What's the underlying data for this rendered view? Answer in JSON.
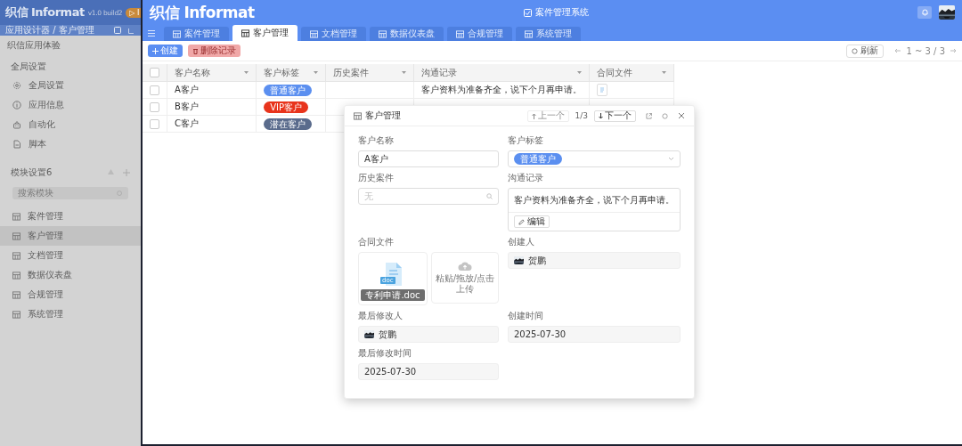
{
  "designer": {
    "logo": "织信 Informat",
    "version": "v1.0 build2",
    "badge": "▷ I",
    "breadcrumb": "应用设计器 / 客户管理",
    "app_name": "织信应用体验",
    "global_section": "全局设置",
    "global_items": [
      {
        "label": "全局设置",
        "kind": "gear"
      },
      {
        "label": "应用信息",
        "kind": "info"
      },
      {
        "label": "自动化",
        "kind": "robot"
      },
      {
        "label": "脚本",
        "kind": "script"
      }
    ],
    "module_section": "模块设置6",
    "module_search": {
      "placeholder": "搜索模块"
    },
    "modules": [
      {
        "label": "案件管理",
        "selected": false
      },
      {
        "label": "客户管理",
        "selected": true
      },
      {
        "label": "文档管理",
        "selected": false
      },
      {
        "label": "数据仪表盘",
        "selected": false
      },
      {
        "label": "合规管理",
        "selected": false
      },
      {
        "label": "系统管理",
        "selected": false
      }
    ]
  },
  "app": {
    "logo": "织信 Informat",
    "title": "案件管理系统",
    "tabs": [
      {
        "label": "案件管理",
        "selected": false
      },
      {
        "label": "客户管理",
        "selected": true
      },
      {
        "label": "文档管理",
        "selected": false
      },
      {
        "label": "数据仪表盘",
        "selected": false
      },
      {
        "label": "合规管理",
        "selected": false
      },
      {
        "label": "系统管理",
        "selected": false
      }
    ],
    "toolbar": {
      "create": {
        "label": "创建",
        "disabled": false
      },
      "delete": {
        "label": "删除记录",
        "disabled": true
      },
      "refresh": "刷新",
      "pager": "1 ~ 3 / 3"
    },
    "table": {
      "select_all": false,
      "columns": [
        "客户名称",
        "客户标签",
        "历史案件",
        "沟通记录",
        "合同文件"
      ],
      "rows": [
        {
          "checked": false,
          "name": "A客户",
          "tag": {
            "label": "普通客户",
            "color": "#5b8ff0"
          },
          "note": "客户资料为准备齐全，说下个月再申请。",
          "has_file": true
        },
        {
          "checked": false,
          "name": "B客户",
          "tag": {
            "label": "VIP客户",
            "color": "#e8341c"
          }
        },
        {
          "checked": false,
          "name": "C客户",
          "tag": {
            "label": "潜在客户",
            "color": "#5a6b8c"
          }
        }
      ]
    }
  },
  "dialog": {
    "title": "客户管理",
    "prev": {
      "label": "上一个",
      "disabled": true
    },
    "position": "1/3",
    "next": {
      "label": "下一个",
      "disabled": false
    },
    "fields": [
      {
        "kind": "text",
        "label": "客户名称",
        "value": "A客户"
      },
      {
        "kind": "tag",
        "label": "客户标签",
        "tag": {
          "label": "普通客户",
          "color": "#5b8ff0"
        }
      },
      {
        "kind": "search",
        "label": "历史案件",
        "placeholder": "无"
      },
      {
        "kind": "note",
        "label": "沟通记录",
        "value": "客户资料为准备齐全，说下个月再申请。",
        "edit": "编辑"
      },
      {
        "kind": "files",
        "label": "合同文件",
        "file_type": "doc",
        "file_name": "专利申请.doc",
        "upload": "粘贴/拖放/点击上传"
      },
      {
        "kind": "user",
        "label": "创建人",
        "value": "贺鹏"
      },
      {
        "kind": "user",
        "label": "最后修改人",
        "value": "贺鹏"
      },
      {
        "kind": "date",
        "label": "创建时间",
        "value": "2025-07-30"
      },
      {
        "kind": "date",
        "label": "最后修改时间",
        "value": "2025-07-30"
      }
    ]
  }
}
